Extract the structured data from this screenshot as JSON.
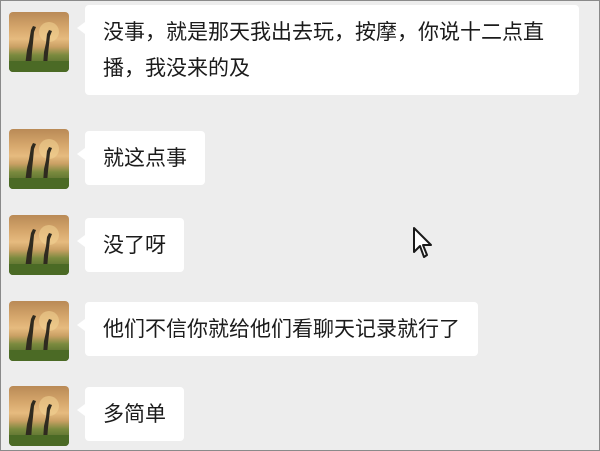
{
  "chat": {
    "messages": [
      {
        "sender": "contact",
        "avatar_icon": "giraffe-avatar-icon",
        "text": "没事，就是那天我出去玩，按摩，你说十二点直播，我没来的及"
      },
      {
        "sender": "contact",
        "avatar_icon": "giraffe-avatar-icon",
        "text": "就这点事"
      },
      {
        "sender": "contact",
        "avatar_icon": "giraffe-avatar-icon",
        "text": "没了呀"
      },
      {
        "sender": "contact",
        "avatar_icon": "giraffe-avatar-icon",
        "text": "他们不信你就给他们看聊天记录就行了"
      },
      {
        "sender": "contact",
        "avatar_icon": "giraffe-avatar-icon",
        "text": "多简单"
      }
    ]
  },
  "colors": {
    "background": "#ededed",
    "bubble": "#ffffff",
    "text": "#1b1b1b"
  },
  "cursor_icon": "mouse-pointer-icon"
}
